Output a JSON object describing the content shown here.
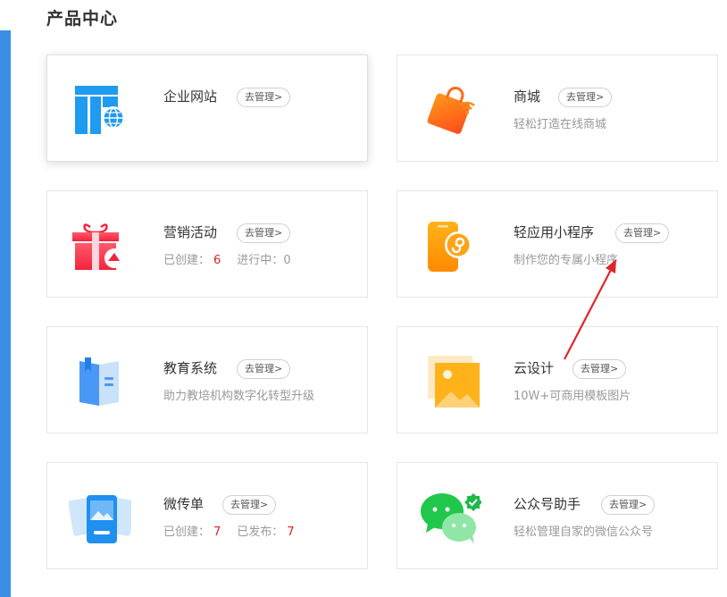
{
  "page_title": "产品中心",
  "manage_label": "去管理>",
  "cards": [
    {
      "name": "企业网站",
      "desc": ""
    },
    {
      "name": "商城",
      "desc": "轻松打造在线商城"
    },
    {
      "name": "营销活动",
      "stat1_label": "已创建：",
      "stat1_value": "6",
      "stat2_label": "进行中：",
      "stat2_value": "0"
    },
    {
      "name": "轻应用小程序",
      "desc": "制作您的专属小程序"
    },
    {
      "name": "教育系统",
      "desc": "助力教培机构数字化转型升级"
    },
    {
      "name": "云设计",
      "desc": "10W+可商用模板图片"
    },
    {
      "name": "微传单",
      "stat1_label": "已创建：",
      "stat1_value": "7",
      "stat2_label": "已发布：",
      "stat2_value": "7"
    },
    {
      "name": "公众号助手",
      "desc": "轻松管理自家的微信公众号"
    }
  ],
  "colors": {
    "accent_blue": "#3a8ee6",
    "stat_red": "#e02020",
    "arrow_red": "#e0252b"
  }
}
